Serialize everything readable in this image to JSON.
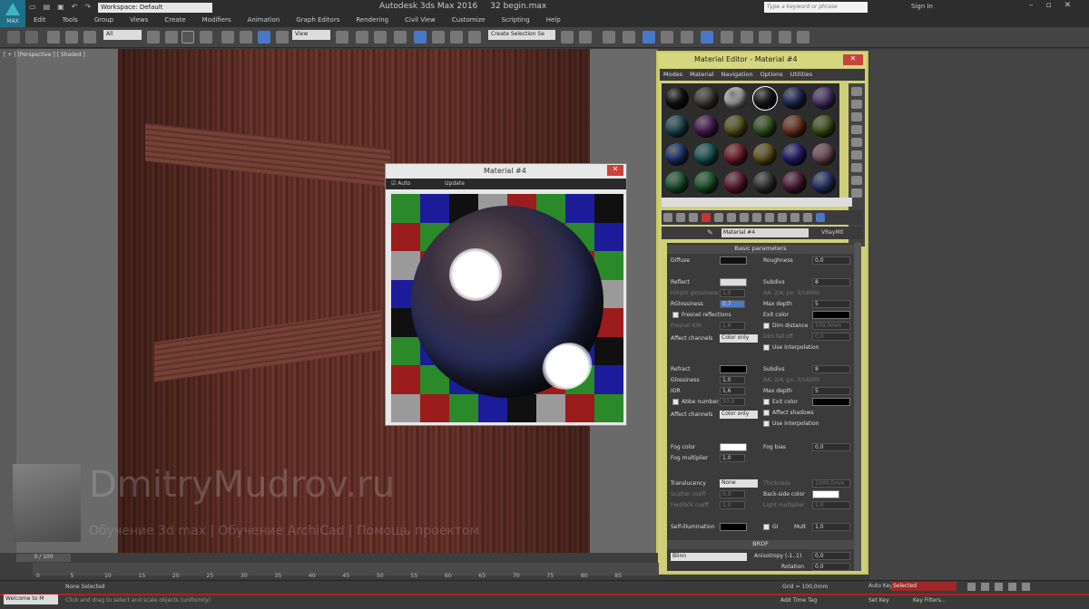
{
  "app": {
    "title": "Autodesk 3ds Max 2016",
    "file": "32 begin.max",
    "workspace": "Workspace: Default",
    "search_placeholder": "Type a keyword or phrase",
    "sign_in": "Sign In",
    "logo_label": "MAX"
  },
  "menu": [
    "Edit",
    "Tools",
    "Group",
    "Views",
    "Create",
    "Modifiers",
    "Animation",
    "Graph Editors",
    "Rendering",
    "Civil View",
    "Customize",
    "Scripting",
    "Help"
  ],
  "toolbar": {
    "selection_filter": "All",
    "ref_coord": "View",
    "named_selection": "Create Selection Se"
  },
  "viewport": {
    "label": "[ + ] [Perspective ] [ Shaded ]"
  },
  "watermark": {
    "title": "DmitryMudrov.ru",
    "subtitle": "Обучение 3d max | Обучение ArchiCad | Помощь проектом"
  },
  "material_window": {
    "title": "Material #4",
    "option_auto": "Auto",
    "option_update": "Update",
    "checker": [
      "#2a8a2a",
      "#1c1c9a",
      "#101010",
      "#9a9a9a",
      "#9a1c1c",
      "#2a8a2a",
      "#1c1c9a",
      "#101010",
      "#9a1c1c",
      "#2a8a2a",
      "#1c1c9a",
      "#101010",
      "#9a9a9a",
      "#9a1c1c",
      "#2a8a2a",
      "#1c1c9a",
      "#9a9a9a",
      "#9a1c1c",
      "#2a8a2a",
      "#1c1c9a",
      "#101010",
      "#9a9a9a",
      "#9a1c1c",
      "#2a8a2a",
      "#1c1c9a",
      "#101010",
      "#9a9a9a",
      "#9a1c1c",
      "#2a8a2a",
      "#1c1c9a",
      "#101010",
      "#9a9a9a",
      "#101010",
      "#9a9a9a",
      "#9a1c1c",
      "#2a8a2a",
      "#1c1c9a",
      "#101010",
      "#9a9a9a",
      "#9a1c1c",
      "#2a8a2a",
      "#1c1c9a",
      "#101010",
      "#9a9a9a",
      "#9a1c1c",
      "#2a8a2a",
      "#1c1c9a",
      "#101010",
      "#9a1c1c",
      "#2a8a2a",
      "#1c1c9a",
      "#101010",
      "#9a9a9a",
      "#9a1c1c",
      "#2a8a2a",
      "#1c1c9a",
      "#9a9a9a",
      "#9a1c1c",
      "#2a8a2a",
      "#1c1c9a",
      "#101010",
      "#9a9a9a",
      "#9a1c1c",
      "#2a8a2a"
    ]
  },
  "editor": {
    "title": "Material Editor - Material #4",
    "menu": [
      "Modes",
      "Material",
      "Navigation",
      "Options",
      "Utilities"
    ],
    "slot_colors": [
      "#1a1a1a",
      "#5a5550",
      "#e0e0e0",
      "#222222",
      "#2c3a7a",
      "#6a4a9a",
      "#2a6a7a",
      "#6a2a7a",
      "#7a7a2a",
      "#4a7a2a",
      "#9a4a2a",
      "#5a7a2a",
      "#2a4a9a",
      "#2a7a7a",
      "#aa2a3a",
      "#8a7a2a",
      "#3a2a9a",
      "#9a6a7a",
      "#2a7a4a",
      "#2a7a3a",
      "#8a2a4a",
      "#4a4a4a",
      "#6a2a4a",
      "#3a4a9a"
    ],
    "material_name": "Material #4",
    "material_type": "VRayMtl",
    "rollout_basic": "Basic parameters",
    "rollout_brdf": "BRDF",
    "diffuse": {
      "label": "Diffuse",
      "roughness_label": "Roughness",
      "roughness": "0,0"
    },
    "reflect": {
      "label": "Reflect",
      "hilight_label": "Hilight glossiness",
      "hilight": "1,0",
      "rglossiness_label": "RGlossiness",
      "rglossiness": "0,7",
      "fresnel_label": "Fresnel reflections",
      "fresnel_ior_label": "Fresnel IOR",
      "fresnel_ior": "1,6",
      "subdivs_label": "Subdivs",
      "subdivs": "8",
      "aa_label": "AA: 2/4; px: 3/16000",
      "maxdepth_label": "Max depth",
      "maxdepth": "5",
      "exit_label": "Exit color",
      "dim_label": "Dim distance",
      "dim": "100,0mm",
      "dimfall_label": "Dim fall off",
      "dimfall": "0,0",
      "affect_label": "Affect channels",
      "affect": "Color only",
      "interp_label": "Use interpolation"
    },
    "refract": {
      "label": "Refract",
      "gloss_label": "Glossiness",
      "gloss": "1,0",
      "ior_label": "IOR",
      "ior": "1,6",
      "abbe_label": "Abbe number",
      "abbe": "50,0",
      "subdivs_label": "Subdivs",
      "subdivs": "8",
      "aa_label": "AA: 2/4; px: 3/16000",
      "maxdepth_label": "Max depth",
      "maxdepth": "5",
      "exit_label": "Exit color",
      "affect_shadows": "Affect shadows",
      "affect_label": "Affect channels",
      "affect": "Color only",
      "interp_label": "Use interpolation"
    },
    "fog": {
      "color_label": "Fog color",
      "bias_label": "Fog bias",
      "bias": "0,0",
      "mult_label": "Fog multiplier",
      "mult": "1,0"
    },
    "translucency": {
      "label": "Translucency",
      "value": "None",
      "thickness_label": "Thickness",
      "thickness": "1000,0mm",
      "scatter_label": "Scatter coeff",
      "scatter": "0,0",
      "backside_label": "Back-side color",
      "fwd_label": "Fwd/bck coeff",
      "fwd": "1,0",
      "light_label": "Light multiplier",
      "light": "1,0"
    },
    "selfillum": {
      "label": "Self-illumination",
      "gi_label": "GI",
      "mult_label": "Mult",
      "mult": "1,0"
    },
    "brdf": {
      "type": "Blinn",
      "aniso_label": "Anisotropy (-1..1)",
      "aniso": "0,0",
      "rotation_label": "Rotation",
      "rotation": "0,0"
    }
  },
  "timeline": {
    "counter": "0 / 100",
    "ticks": [
      "0",
      "5",
      "10",
      "15",
      "20",
      "25",
      "30",
      "35",
      "40",
      "45",
      "50",
      "55",
      "60",
      "65",
      "70",
      "75",
      "80",
      "85"
    ]
  },
  "status": {
    "listener": "Welcome to M",
    "line1": "None Selected",
    "line2": "Click and drag to select and scale objects (uniformly)",
    "grid": "Grid = 100,0mm",
    "auto_key": "Auto Key",
    "selected": "Selected",
    "set_key": "Set Key",
    "key_filters": "Key Filters...",
    "add_time_tag": "Add Time Tag"
  }
}
